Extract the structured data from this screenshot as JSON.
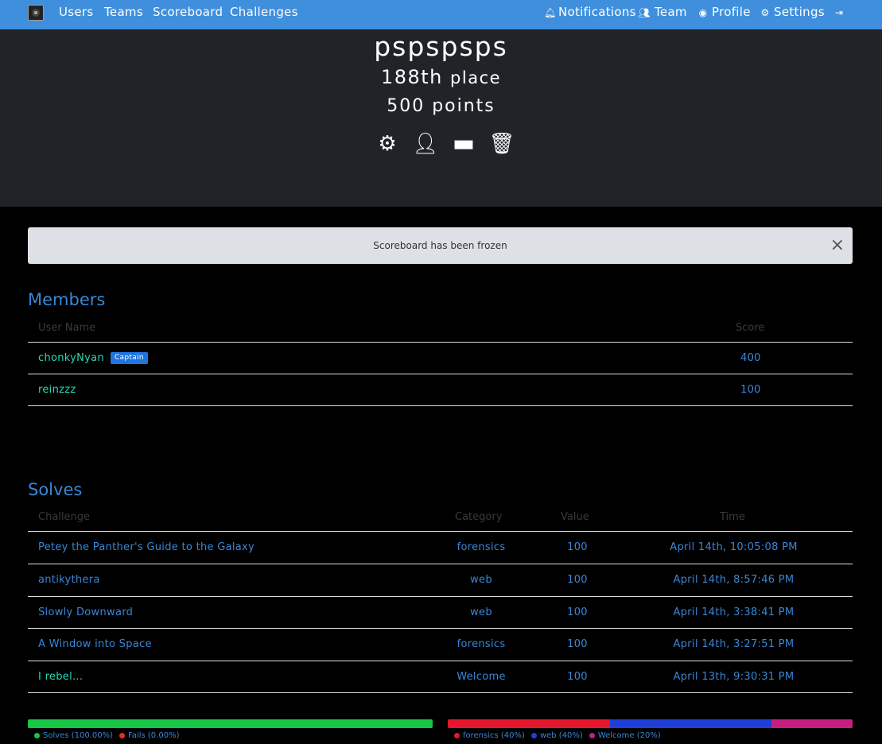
{
  "nav": {
    "left": [
      "Users",
      "Teams",
      "Scoreboard",
      "Challenges"
    ],
    "right": [
      {
        "label": "Notifications",
        "icon": "bell-icon"
      },
      {
        "label": "Team",
        "icon": "users-icon"
      },
      {
        "label": "Profile",
        "icon": "user-circle-icon"
      },
      {
        "label": "Settings",
        "icon": "gears-icon"
      },
      {
        "label": "",
        "icon": "logout-icon"
      }
    ]
  },
  "hero": {
    "team_name": "pspspsps",
    "place_num": "188th",
    "place_word": "place",
    "points": "500 points"
  },
  "alert": {
    "text": "Scoreboard has been frozen",
    "close": "×"
  },
  "members": {
    "title": "Members",
    "headers": {
      "name": "User Name",
      "score": "Score"
    },
    "rows": [
      {
        "name": "chonkyNyan",
        "badge": "Captain",
        "score": "400"
      },
      {
        "name": "reinzzz",
        "badge": "",
        "score": "100"
      }
    ]
  },
  "solves": {
    "title": "Solves",
    "headers": {
      "challenge": "Challenge",
      "category": "Category",
      "value": "Value",
      "time": "Time"
    },
    "rows": [
      {
        "challenge": "Petey the Panther's Guide to the Galaxy",
        "category": "forensics",
        "value": "100",
        "time": "April 14th, 10:05:08 PM"
      },
      {
        "challenge": "antikythera",
        "category": "web",
        "value": "100",
        "time": "April 14th, 8:57:46 PM"
      },
      {
        "challenge": "Slowly Downward",
        "category": "web",
        "value": "100",
        "time": "April 14th, 3:38:41 PM"
      },
      {
        "challenge": "A Window into Space",
        "category": "forensics",
        "value": "100",
        "time": "April 14th, 3:27:51 PM"
      },
      {
        "challenge": "I rebel...",
        "category": "Welcome",
        "value": "100",
        "time": "April 13th, 9:30:31 PM"
      }
    ]
  },
  "charts": {
    "solve_bar": {
      "segments": [
        {
          "label": "Solves (100.00%)",
          "fraction": 1.0,
          "color": "#17c644"
        },
        {
          "label": "Fails (0.00%)",
          "fraction": 0.0,
          "color": "#e0301e"
        }
      ]
    },
    "category_bar": {
      "segments": [
        {
          "label": "forensics (40%)",
          "fraction": 0.4,
          "color": "#e5172e"
        },
        {
          "label": "web (40%)",
          "fraction": 0.4,
          "color": "#1f3fd8"
        },
        {
          "label": "Welcome (20%)",
          "fraction": 0.2,
          "color": "#c41f7f"
        }
      ]
    }
  }
}
